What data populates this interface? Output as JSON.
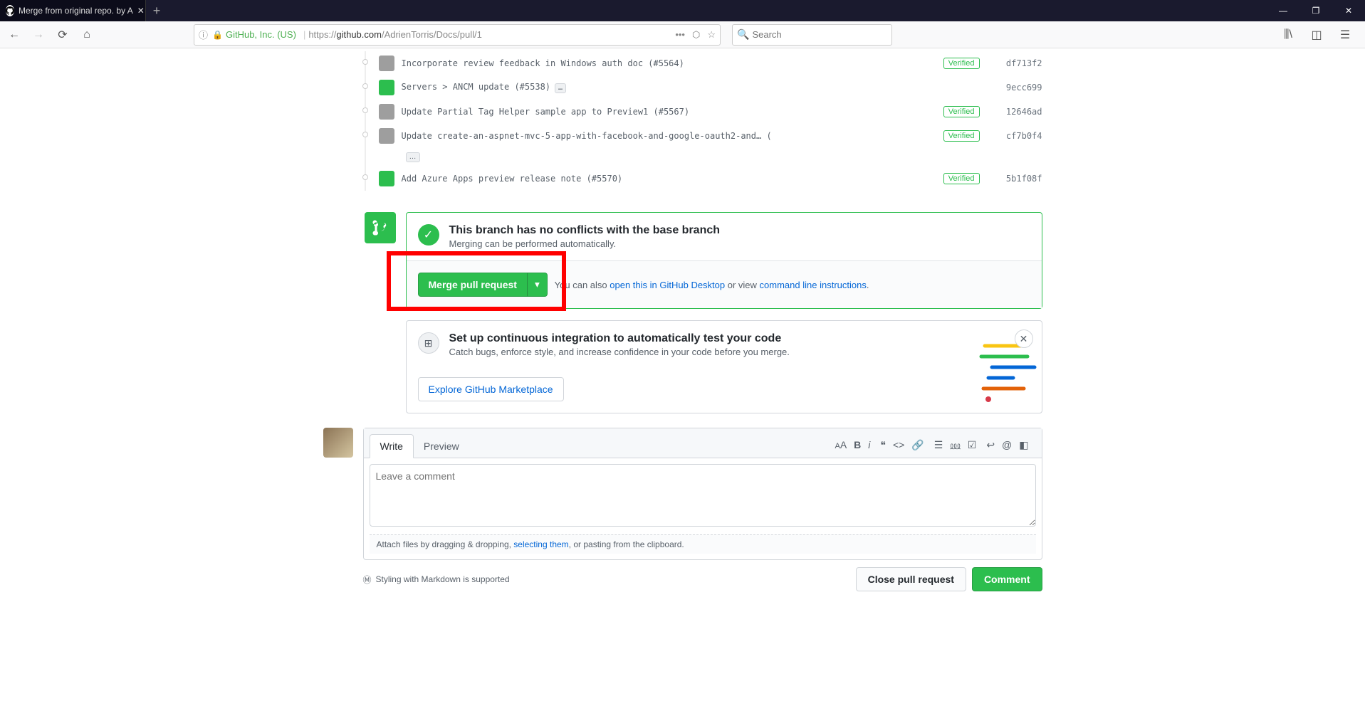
{
  "browser": {
    "tab_title": "Merge from original repo. by A",
    "url_org": "GitHub, Inc. (US)",
    "url_proto": "https://",
    "url_host": "github.com",
    "url_path": "/AdrienTorris/Docs/pull/1",
    "search_placeholder": "Search"
  },
  "commits": [
    {
      "msg": "Incorporate review feedback in Windows auth doc (#5564)",
      "verified": true,
      "sha": "df713f2",
      "avatar": "a",
      "ellipsis": false
    },
    {
      "msg": "Servers > ANCM update (#5538)",
      "verified": false,
      "sha": "9ecc699",
      "avatar": "dino",
      "ellipsis": true
    },
    {
      "msg": "Update Partial Tag Helper sample app to Preview1 (#5567)",
      "verified": true,
      "sha": "12646ad",
      "avatar": "b",
      "ellipsis": false
    },
    {
      "msg": "Update create-an-aspnet-mvc-5-app-with-facebook-and-google-oauth2-and… (",
      "verified": true,
      "sha": "cf7b0f4",
      "avatar": "c",
      "ellipsis": true,
      "ellipsis_below": true
    },
    {
      "msg": "Add Azure Apps preview release note (#5570)",
      "verified": true,
      "sha": "5b1f08f",
      "avatar": "dino",
      "ellipsis": false
    }
  ],
  "merge": {
    "title": "This branch has no conflicts with the base branch",
    "sub": "Merging can be performed automatically.",
    "button": "Merge pull request",
    "text_prefix": "You can also ",
    "link_desktop": "open this in GitHub Desktop",
    "text_mid": " or view ",
    "link_cli": "command line instructions",
    "text_suffix": "."
  },
  "ci": {
    "title": "Set up continuous integration to automatically test your code",
    "sub": "Catch bugs, enforce style, and increase confidence in your code before you merge.",
    "button": "Explore GitHub Marketplace"
  },
  "comment": {
    "tab_write": "Write",
    "tab_preview": "Preview",
    "placeholder": "Leave a comment",
    "attach_prefix": "Attach files by dragging & dropping, ",
    "attach_link": "selecting them",
    "attach_suffix": ", or pasting from the clipboard.",
    "md_note": "Styling with Markdown is supported",
    "close_btn": "Close pull request",
    "comment_btn": "Comment"
  }
}
